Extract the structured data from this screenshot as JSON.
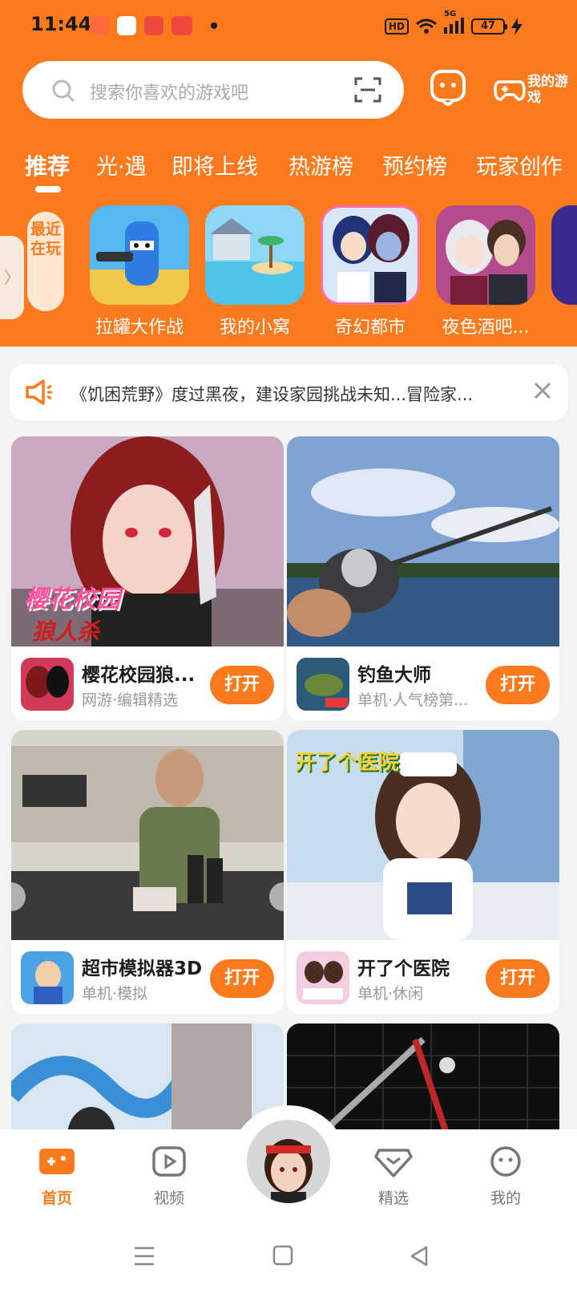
{
  "status_bar": {
    "time": "11:44",
    "hd": "HD",
    "battery": "47",
    "signal": "5G"
  },
  "search": {
    "placeholder": "搜索你喜欢的游戏吧",
    "my_games_label": "我的游戏"
  },
  "tabs": [
    "推荐",
    "光·遇",
    "即将上线",
    "热游榜",
    "预约榜",
    "玩家创作"
  ],
  "recent": {
    "tag": "最近在玩",
    "games": [
      "拉罐大作战",
      "我的小窝",
      "奇幻都市",
      "夜色酒吧..."
    ]
  },
  "notice": {
    "text": "《饥困荒野》度过黑夜，建设家园挑战未知...冒险家..."
  },
  "cards": [
    {
      "title": "樱花校园狼...",
      "sub": "网游·编辑精选",
      "button": "打开",
      "art_label": "樱花校园",
      "art_label2": "狼人杀"
    },
    {
      "title": "钓鱼大师",
      "sub": "单机·人气榜第...",
      "button": "打开"
    },
    {
      "title": "超市模拟器3D",
      "sub": "单机·模拟",
      "button": "打开"
    },
    {
      "title": "开了个医院",
      "sub": "单机·休闲",
      "button": "打开",
      "art_label": "开了个医院"
    }
  ],
  "bottom_nav": [
    "首页",
    "视频",
    "精选",
    "我的"
  ],
  "colors": {
    "accent": "#fb7a1e",
    "background": "#f3f3f3"
  }
}
